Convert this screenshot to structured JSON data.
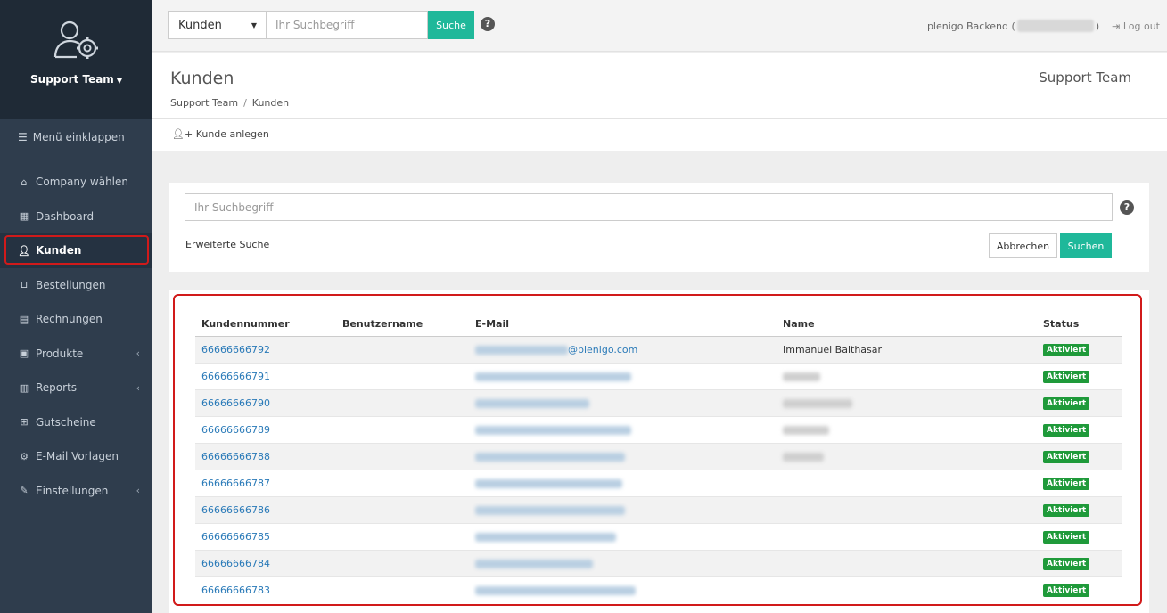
{
  "sidebar": {
    "team": "Support Team",
    "collapse_label": "Menü einklappen",
    "items": [
      {
        "label": "Company wählen",
        "icon": "home-icon"
      },
      {
        "label": "Dashboard",
        "icon": "grid-icon"
      },
      {
        "label": "Kunden",
        "icon": "user-icon",
        "active": true
      },
      {
        "label": "Bestellungen",
        "icon": "basket-icon"
      },
      {
        "label": "Rechnungen",
        "icon": "document-icon"
      },
      {
        "label": "Produkte",
        "icon": "box-icon",
        "has_submenu": true
      },
      {
        "label": "Reports",
        "icon": "bar-chart-icon",
        "has_submenu": true
      },
      {
        "label": "Gutscheine",
        "icon": "gift-icon"
      },
      {
        "label": "E-Mail Vorlagen",
        "icon": "cogs-icon"
      },
      {
        "label": "Einstellungen",
        "icon": "wrench-icon",
        "has_submenu": true
      }
    ]
  },
  "topbar": {
    "select_value": "Kunden",
    "search_placeholder": "Ihr Suchbegriff",
    "search_button": "Suche",
    "user_prefix": "plenigo Backend (",
    "user_suffix": ")",
    "logout": "Log out"
  },
  "header": {
    "title": "Kunden",
    "breadcrumb": [
      "Support Team",
      "Kunden"
    ],
    "right": "Support Team"
  },
  "actions": {
    "add_customer": "Kunde anlegen"
  },
  "search_panel": {
    "placeholder": "Ihr Suchbegriff",
    "extended": "Erweiterte Suche",
    "cancel": "Abbrechen",
    "submit": "Suchen"
  },
  "table": {
    "columns": [
      "Kundennummer",
      "Benutzername",
      "E-Mail",
      "Name",
      "Status"
    ],
    "rows": [
      {
        "id": "66666666792",
        "email_domain": "@plenigo.com",
        "name": "Immanuel Balthasar",
        "status": "Aktiviert"
      },
      {
        "id": "66666666791",
        "status": "Aktiviert"
      },
      {
        "id": "66666666790",
        "status": "Aktiviert"
      },
      {
        "id": "66666666789",
        "status": "Aktiviert"
      },
      {
        "id": "66666666788",
        "status": "Aktiviert"
      },
      {
        "id": "66666666787",
        "status": "Aktiviert"
      },
      {
        "id": "66666666786",
        "status": "Aktiviert"
      },
      {
        "id": "66666666785",
        "status": "Aktiviert"
      },
      {
        "id": "66666666784",
        "status": "Aktiviert"
      },
      {
        "id": "66666666783",
        "status": "Aktiviert"
      }
    ]
  },
  "colors": {
    "accent": "#1fb89a",
    "sidebar_bg": "#2f3d4d",
    "badge": "#1f9a3a",
    "highlight": "#d11a1a"
  }
}
